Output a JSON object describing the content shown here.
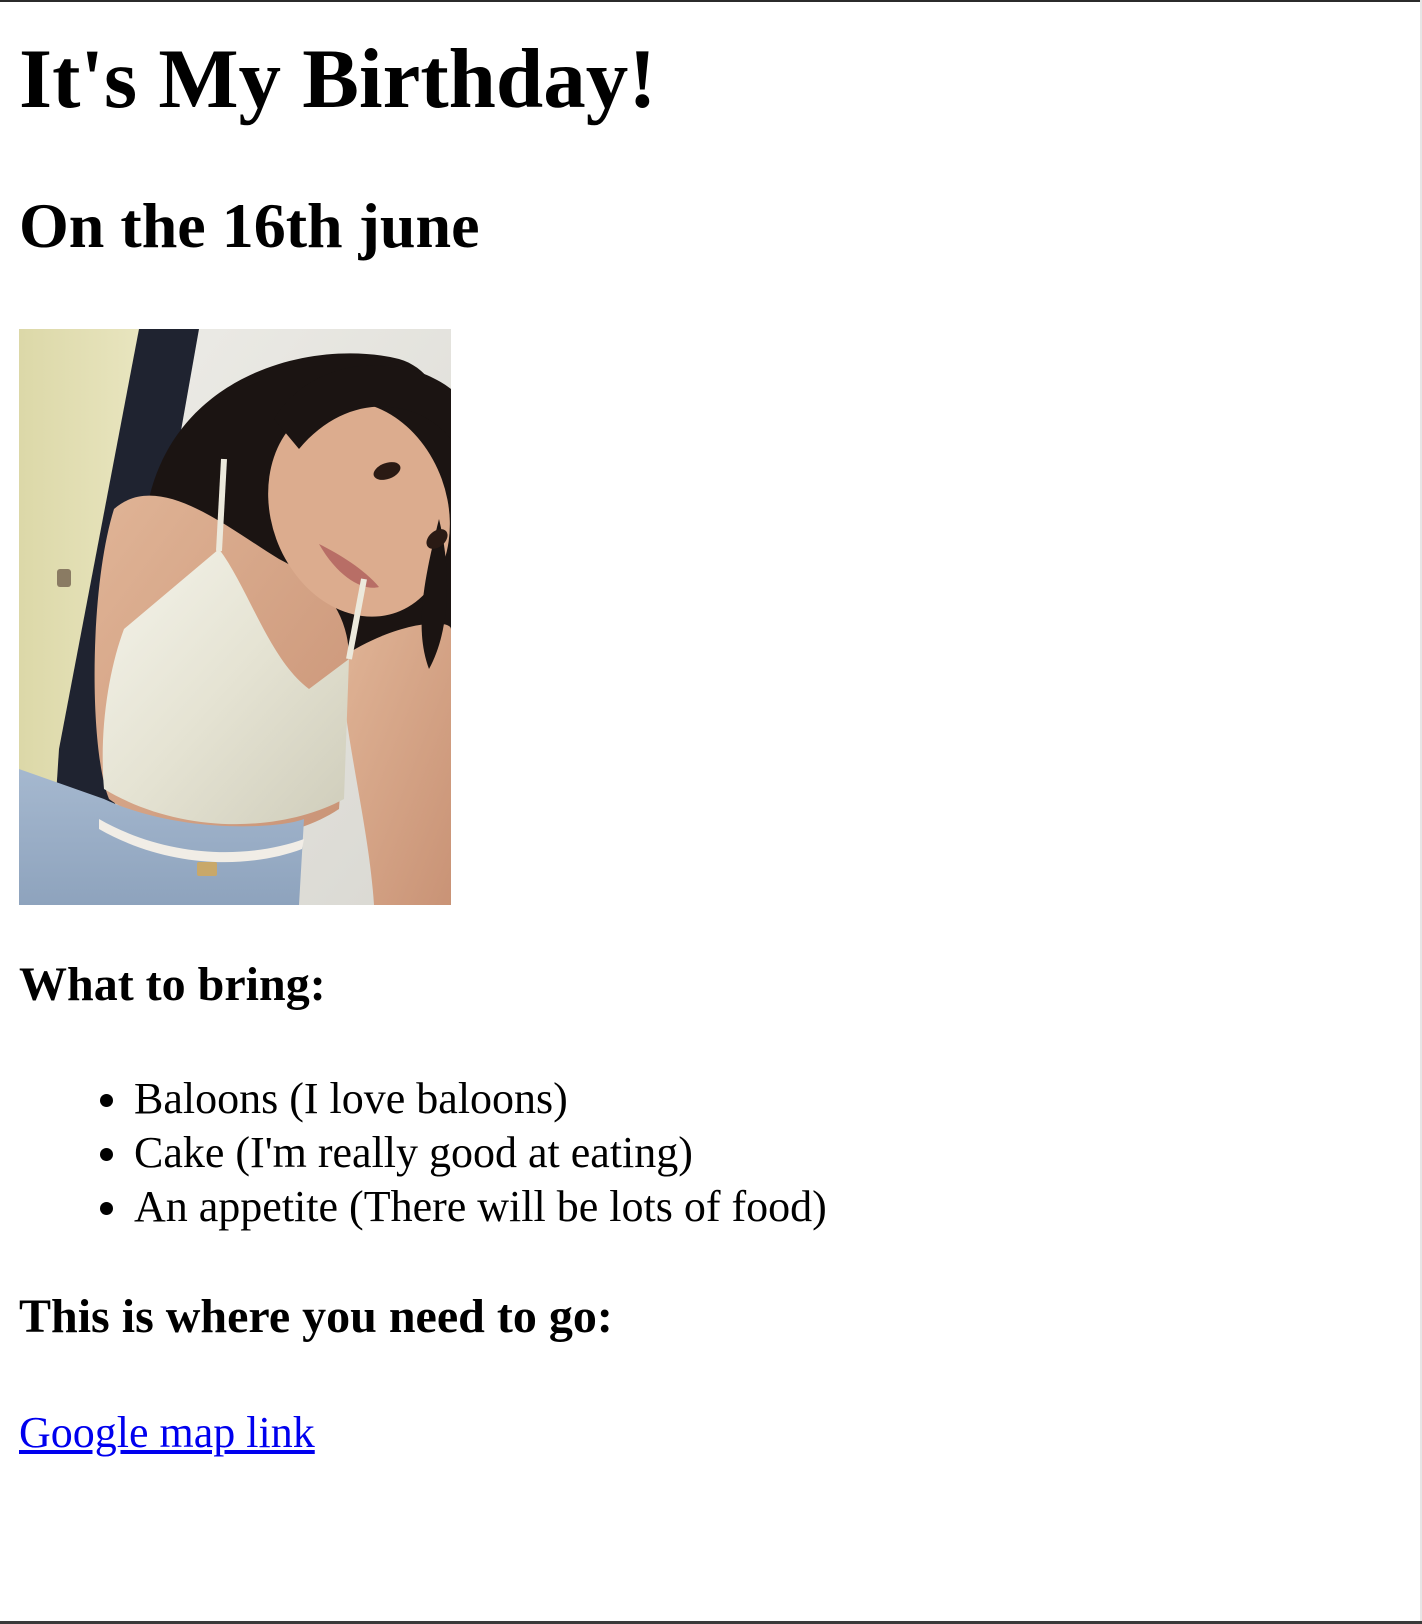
{
  "page": {
    "title": "It's My Birthday!",
    "subtitle": "On the 16th june"
  },
  "photo": {
    "icon": "selfie-photo"
  },
  "bring": {
    "heading": "What to bring:",
    "items": [
      {
        "label": "Baloons (I love baloons)"
      },
      {
        "label": "Cake (I'm really good at eating)"
      },
      {
        "label": "An appetite (There will be lots of food)"
      }
    ]
  },
  "directions": {
    "heading": "This is where you need to go:",
    "link_label": "Google map link"
  },
  "colors": {
    "link": "#0000ee",
    "text": "#000000",
    "background": "#ffffff"
  }
}
